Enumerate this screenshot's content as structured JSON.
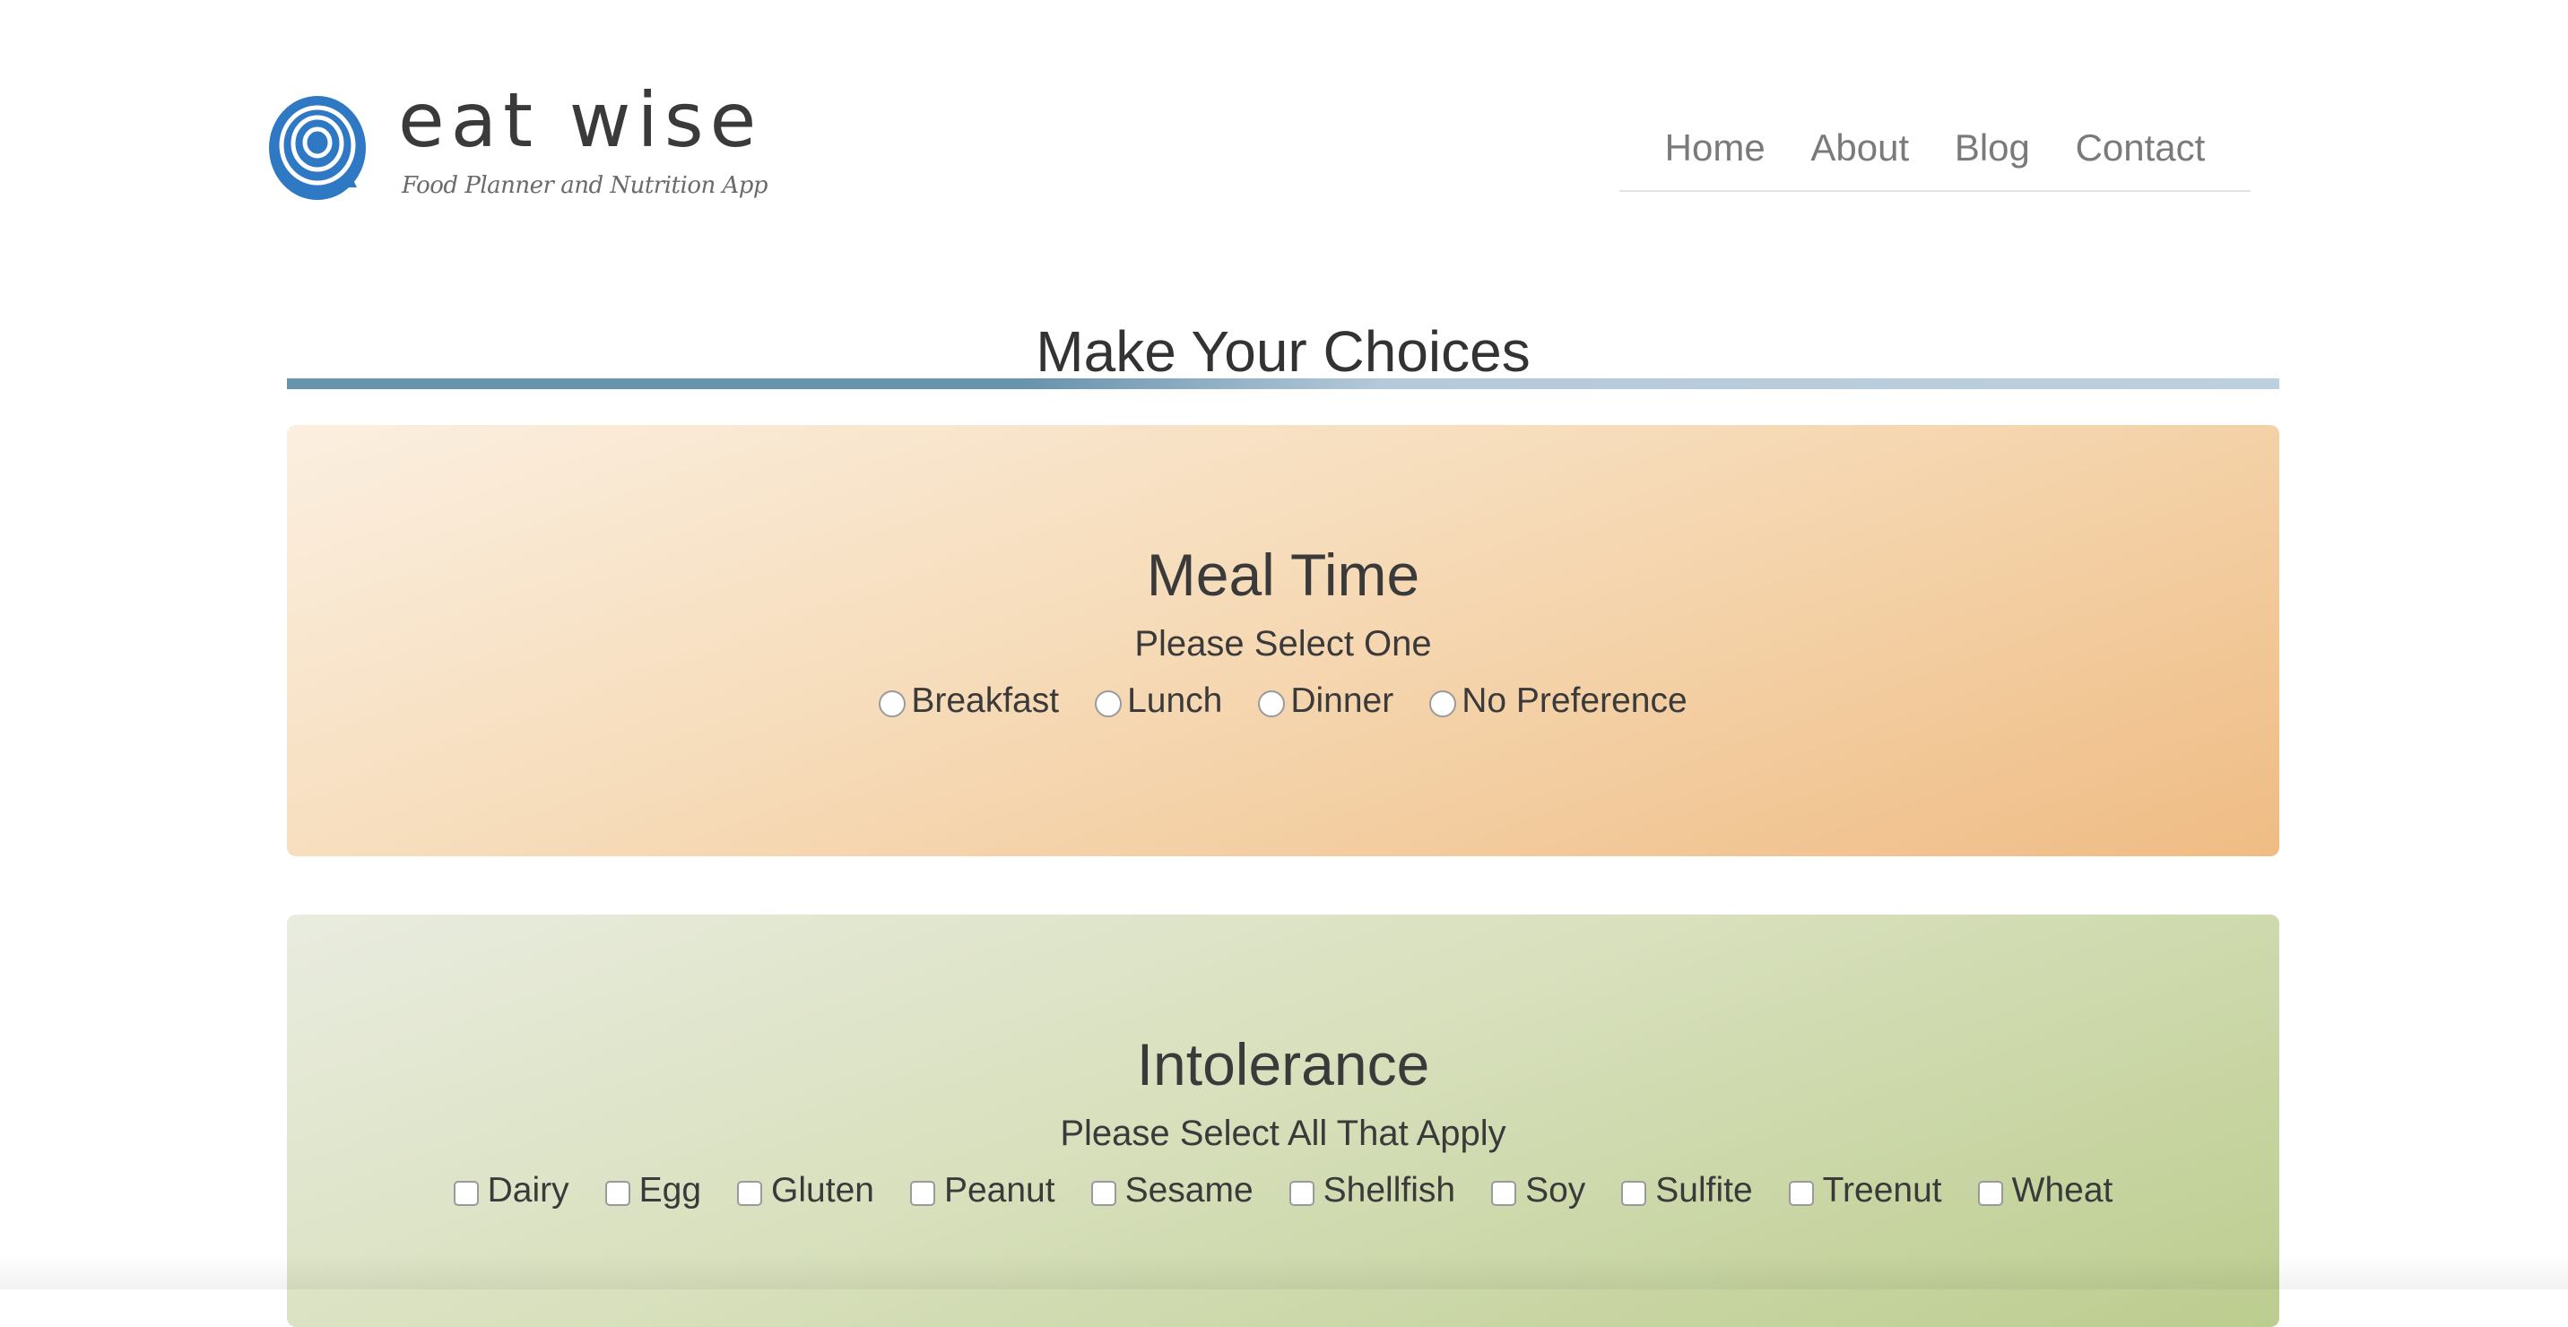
{
  "brand": {
    "name": "eat wise",
    "tagline": "Food Planner and Nutrition App",
    "logo_icon": "onion-rings-icon",
    "logo_color": "#2f78c4"
  },
  "nav": {
    "items": [
      {
        "label": "Home"
      },
      {
        "label": "About"
      },
      {
        "label": "Blog"
      },
      {
        "label": "Contact"
      }
    ]
  },
  "main": {
    "title": "Make Your Choices"
  },
  "meal_time": {
    "title": "Meal Time",
    "subtitle": "Please Select One",
    "options": [
      {
        "label": "Breakfast"
      },
      {
        "label": "Lunch"
      },
      {
        "label": "Dinner"
      },
      {
        "label": "No Preference"
      }
    ]
  },
  "intolerance": {
    "title": "Intolerance",
    "subtitle": "Please Select All That Apply",
    "options": [
      {
        "label": "Dairy"
      },
      {
        "label": "Egg"
      },
      {
        "label": "Gluten"
      },
      {
        "label": "Peanut"
      },
      {
        "label": "Sesame"
      },
      {
        "label": "Shellfish"
      },
      {
        "label": "Soy"
      },
      {
        "label": "Sulfite"
      },
      {
        "label": "Treenut"
      },
      {
        "label": "Wheat"
      }
    ]
  },
  "colors": {
    "meal_card": "#efbc84",
    "intolerance_card": "#bccd8f",
    "title_rule": "#6893ad"
  }
}
